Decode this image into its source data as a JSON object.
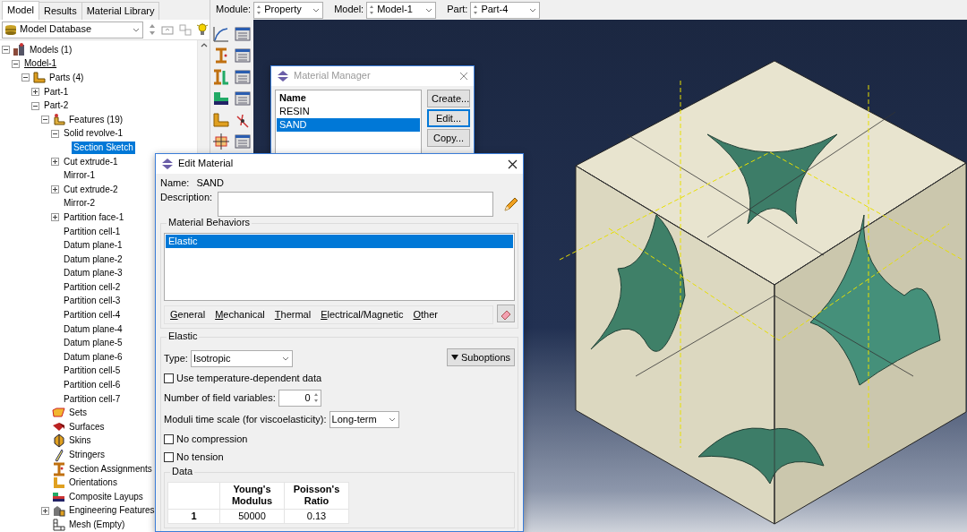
{
  "tabs": [
    {
      "label": "Model",
      "selected": true
    },
    {
      "label": "Results",
      "selected": false
    },
    {
      "label": "Material Library",
      "selected": false
    }
  ],
  "model_selector": {
    "value": "Model Database"
  },
  "context_bar": [
    {
      "label": "Module:",
      "value": "Property"
    },
    {
      "label": "Model:",
      "value": "Model-1"
    },
    {
      "label": "Part:",
      "value": "Part-4"
    }
  ],
  "tree": [
    {
      "label": "Models (1)",
      "kind": "models",
      "expanded": true,
      "selected": false,
      "children": [
        {
          "label": "Model-1",
          "current": true,
          "expanded": true,
          "selected": false,
          "children": [
            {
              "label": "Parts (4)",
              "kind": "parts",
              "expanded": true,
              "selected": false,
              "children": [
                {
                  "label": "Part-1",
                  "expanded": false,
                  "selected": false
                },
                {
                  "label": "Part-2",
                  "expanded": true,
                  "selected": false,
                  "children": [
                    {
                      "label": "Features (19)",
                      "kind": "features",
                      "expanded": true,
                      "selected": false,
                      "children": [
                        {
                          "label": "Solid revolve-1",
                          "expanded": true,
                          "selected": false,
                          "children": [
                            {
                              "label": "Section Sketch",
                              "selected": true
                            }
                          ]
                        },
                        {
                          "label": "Cut extrude-1",
                          "expanded": false,
                          "selected": false
                        },
                        {
                          "label": "Mirror-1",
                          "selected": false
                        },
                        {
                          "label": "Cut extrude-2",
                          "expanded": false,
                          "selected": false
                        },
                        {
                          "label": "Mirror-2",
                          "selected": false
                        },
                        {
                          "label": "Partition face-1",
                          "expanded": false,
                          "selected": false
                        },
                        {
                          "label": "Partition cell-1",
                          "selected": false
                        },
                        {
                          "label": "Datum plane-1",
                          "selected": false
                        },
                        {
                          "label": "Datum plane-2",
                          "selected": false
                        },
                        {
                          "label": "Datum plane-3",
                          "selected": false
                        },
                        {
                          "label": "Partition cell-2",
                          "selected": false
                        },
                        {
                          "label": "Partition cell-3",
                          "selected": false
                        },
                        {
                          "label": "Partition cell-4",
                          "selected": false
                        },
                        {
                          "label": "Datum plane-4",
                          "selected": false
                        },
                        {
                          "label": "Datum plane-5",
                          "selected": false
                        },
                        {
                          "label": "Datum plane-6",
                          "selected": false
                        },
                        {
                          "label": "Partition cell-5",
                          "selected": false
                        },
                        {
                          "label": "Partition cell-6",
                          "selected": false
                        },
                        {
                          "label": "Partition cell-7",
                          "selected": false
                        }
                      ]
                    },
                    {
                      "label": "Sets",
                      "kind": "sets",
                      "selected": false
                    },
                    {
                      "label": "Surfaces",
                      "kind": "surfaces",
                      "selected": false
                    },
                    {
                      "label": "Skins",
                      "kind": "skins",
                      "selected": false
                    },
                    {
                      "label": "Stringers",
                      "kind": "stringers",
                      "selected": false
                    },
                    {
                      "label": "Section Assignments",
                      "kind": "sections",
                      "selected": false
                    },
                    {
                      "label": "Orientations",
                      "kind": "orientations",
                      "selected": false
                    },
                    {
                      "label": "Composite Layups",
                      "kind": "layups",
                      "selected": false
                    },
                    {
                      "label": "Engineering Features",
                      "kind": "engineering",
                      "expanded": false,
                      "selected": false
                    },
                    {
                      "label": "Mesh (Empty)",
                      "kind": "mesh",
                      "selected": false
                    }
                  ]
                }
              ]
            }
          ]
        }
      ]
    }
  ],
  "material_manager": {
    "title": "Material Manager",
    "column": "Name",
    "materials": [
      {
        "name": "RESIN",
        "selected": false
      },
      {
        "name": "SAND",
        "selected": true
      }
    ],
    "buttons": [
      {
        "label": "Create...",
        "focused": false
      },
      {
        "label": "Edit...",
        "focused": true
      },
      {
        "label": "Copy...",
        "focused": false
      }
    ]
  },
  "edit_material": {
    "title": "Edit Material",
    "name_label": "Name:",
    "name": "SAND",
    "description_label": "Description:",
    "behaviors_title": "Material Behaviors",
    "behaviors": [
      {
        "name": "Elastic",
        "selected": true
      }
    ],
    "menus": [
      "General",
      "Mechanical",
      "Thermal",
      "Electrical/Magnetic",
      "Other"
    ],
    "section_title": "Elastic",
    "type_label": "Type:",
    "type": "Isotropic",
    "suboptions": "Suboptions",
    "options": [
      {
        "kind": "checkbox",
        "label": "Use temperature-dependent data",
        "checked": false
      },
      {
        "kind": "spinner",
        "label": "Number of field variables:",
        "value": "0"
      },
      {
        "kind": "select",
        "label": "Moduli time scale (for viscoelasticity):",
        "value": "Long-term"
      },
      {
        "kind": "checkbox",
        "label": "No compression",
        "checked": false
      },
      {
        "kind": "checkbox",
        "label": "No tension",
        "checked": false
      }
    ],
    "data_title": "Data",
    "table": {
      "columns": [
        "Young's Modulus",
        "Poisson's Ratio"
      ],
      "rows": [
        {
          "index": "1",
          "cells": [
            "50000",
            "0.13"
          ]
        }
      ]
    }
  }
}
